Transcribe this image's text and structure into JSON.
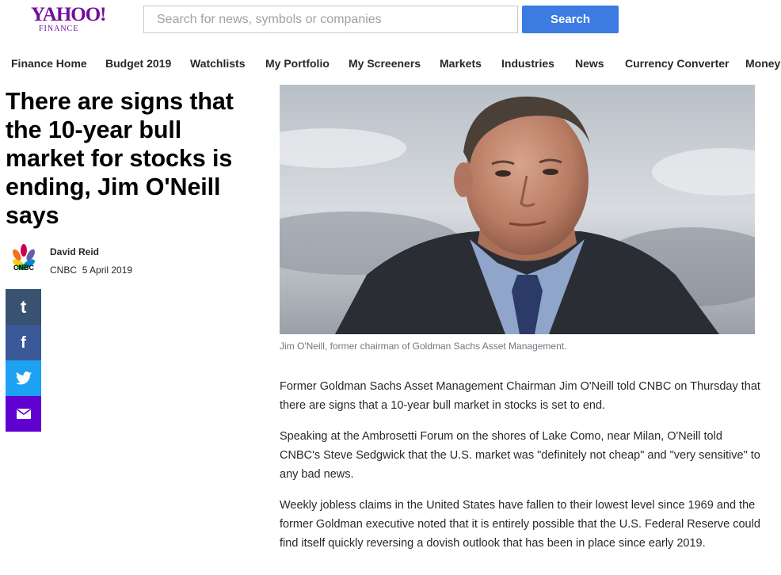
{
  "header": {
    "logo_main": "YAHOO!",
    "logo_sub": "FINANCE",
    "search_placeholder": "Search for news, symbols or companies",
    "search_button": "Search"
  },
  "nav": {
    "items": [
      "Finance Home",
      "Budget 2019",
      "Watchlists",
      "My Portfolio",
      "My Screeners",
      "Markets",
      "Industries",
      "News",
      "Currency Converter",
      "Money"
    ]
  },
  "article": {
    "title": "There are signs that the 10-year bull market for stocks is ending, Jim O'Neill says",
    "author": "David Reid",
    "provider": "CNBC",
    "date": "5 April 2019",
    "provider_logo_text": "CNBC",
    "caption": "Jim O'Neill, former chairman of Goldman Sachs Asset Management.",
    "paragraphs": [
      "Former Goldman Sachs Asset Management Chairman Jim O'Neill told CNBC on Thursday that there are signs that a 10-year bull market in stocks is set to end.",
      "Speaking at the Ambrosetti Forum on the shores of Lake Como, near Milan, O'Neill told CNBC's Steve Sedgwick that the U.S. market was \"definitely not cheap\" and \"very sensitive\" to any bad news.",
      "Weekly jobless claims in the United States have fallen to their lowest level since 1969 and the former Goldman executive noted that it is entirely possible that the U.S. Federal Reserve could find itself quickly reversing a dovish outlook that has been in place since early 2019."
    ]
  },
  "share": {
    "items": [
      {
        "name": "tumblr-icon",
        "glyph": "t"
      },
      {
        "name": "facebook-icon",
        "glyph": "f"
      },
      {
        "name": "twitter-icon",
        "glyph": "bird"
      },
      {
        "name": "mail-icon",
        "glyph": "envelope"
      }
    ]
  },
  "colors": {
    "brand": "#720e9e",
    "search_button": "#3b7be2",
    "tumblr": "#395272",
    "facebook": "#3b5998",
    "twitter": "#1da1f2",
    "mail": "#6001d2"
  }
}
